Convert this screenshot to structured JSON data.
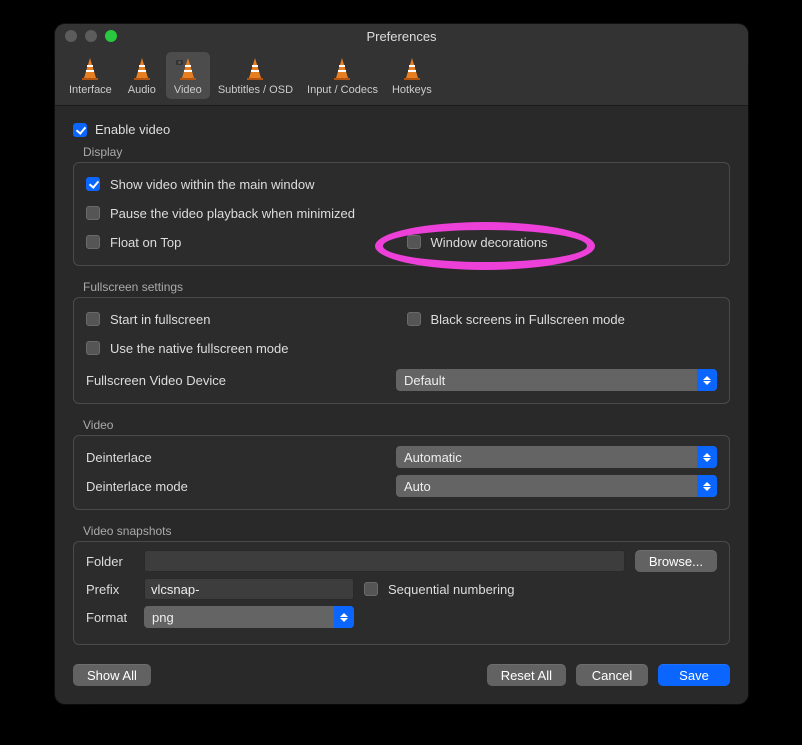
{
  "window_title": "Preferences",
  "tabs": [
    {
      "label": "Interface"
    },
    {
      "label": "Audio"
    },
    {
      "label": "Video"
    },
    {
      "label": "Subtitles / OSD"
    },
    {
      "label": "Input / Codecs"
    },
    {
      "label": "Hotkeys"
    }
  ],
  "enable_video_label": "Enable video",
  "display": {
    "section": "Display",
    "show_in_main": "Show video within the main window",
    "pause_minimized": "Pause the video playback when minimized",
    "float_on_top": "Float on Top",
    "window_decorations": "Window decorations"
  },
  "fullscreen_settings": {
    "section": "Fullscreen settings",
    "start_fullscreen": "Start in fullscreen",
    "black_screens": "Black screens in Fullscreen mode",
    "native_fullscreen": "Use the native fullscreen mode",
    "device_label": "Fullscreen Video Device",
    "device_value": "Default"
  },
  "video": {
    "section": "Video",
    "deinterlace_label": "Deinterlace",
    "deinterlace_value": "Automatic",
    "deinterlace_mode_label": "Deinterlace mode",
    "deinterlace_mode_value": "Auto"
  },
  "snapshots": {
    "section": "Video snapshots",
    "folder_label": "Folder",
    "folder_value": "",
    "browse_label": "Browse...",
    "prefix_label": "Prefix",
    "prefix_value": "vlcsnap-",
    "sequential_label": "Sequential numbering",
    "format_label": "Format",
    "format_value": "png"
  },
  "buttons": {
    "show_all": "Show All",
    "reset_all": "Reset All",
    "cancel": "Cancel",
    "save": "Save"
  }
}
